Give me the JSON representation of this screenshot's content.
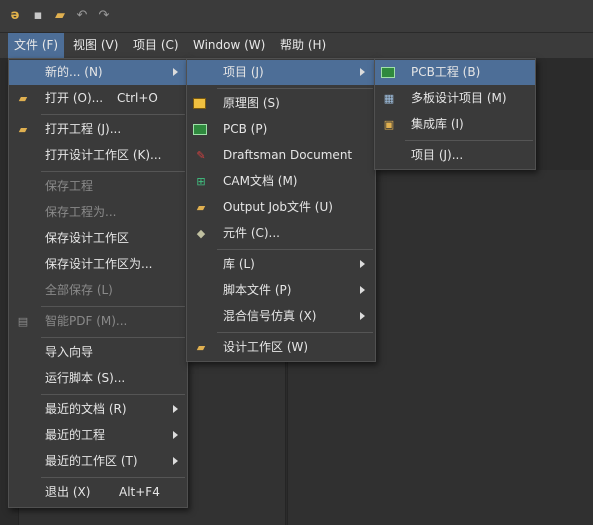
{
  "menubar": {
    "file": "文件 (F)",
    "view": "视图 (V)",
    "project": "项目 (C)",
    "window": "Window (W)",
    "help": "帮助 (H)"
  },
  "file_menu": {
    "new": "新的... (N)",
    "open": "打开 (O)...",
    "open_shortcut": "Ctrl+O",
    "open_project": "打开工程 (J)...",
    "open_workspace": "打开设计工作区 (K)...",
    "save_project": "保存工程",
    "save_project_as": "保存工程为...",
    "save_workspace": "保存设计工作区",
    "save_workspace_as": "保存设计工作区为...",
    "save_all": "全部保存 (L)",
    "smart_pdf": "智能PDF (M)...",
    "import_wizard": "导入向导",
    "run_script": "运行脚本 (S)...",
    "recent_docs": "最近的文档 (R)",
    "recent_projects": "最近的工程",
    "recent_workspaces": "最近的工作区 (T)",
    "exit": "退出 (X)",
    "exit_shortcut": "Alt+F4"
  },
  "new_menu": {
    "project": "项目 (J)",
    "schematic": "原理图 (S)",
    "pcb": "PCB (P)",
    "draftsman": "Draftsman Document",
    "cam": "CAM文档 (M)",
    "output_job": "Output Job文件 (U)",
    "component": "元件 (C)...",
    "library": "库 (L)",
    "script_file": "脚本文件 (P)",
    "mixed_sim": "混合信号仿真 (X)",
    "design_workspace": "设计工作区 (W)"
  },
  "project_menu": {
    "pcb_project": "PCB工程 (B)",
    "multiboard": "多板设计项目 (M)",
    "integrated_lib": "集成库 (I)",
    "project_more": "项目 (J)..."
  },
  "colors": {
    "highlight": "#4d6e97",
    "menu_bg": "#3a3a3a",
    "disabled_text": "#8a8a8a"
  }
}
